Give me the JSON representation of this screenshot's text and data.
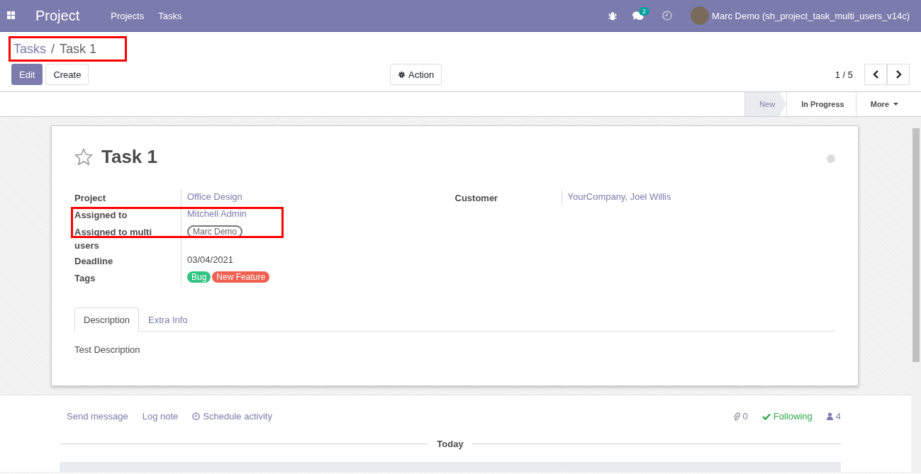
{
  "navbar": {
    "app_name": "Project",
    "menu": [
      "Projects",
      "Tasks"
    ],
    "chat_count": "2",
    "user": "Marc Demo (sh_project_task_multi_users_v14c)"
  },
  "breadcrumb": {
    "highlighted": true,
    "items": [
      "Tasks",
      "Task 1"
    ],
    "separator": "/"
  },
  "buttons": {
    "primary": "Edit",
    "secondary": "Create",
    "action": "Action"
  },
  "pager": "1 / 5",
  "stages": [
    {
      "label": "New",
      "selected": true
    },
    {
      "label": "In Progress",
      "selected": false
    },
    {
      "label": "More",
      "selected": false
    }
  ],
  "sheet": {
    "title": "Task 1",
    "starred": false,
    "left_fields": [
      {
        "label": "Project",
        "kind": "link",
        "value": "Office Design"
      },
      {
        "kind": "annotation",
        "fields": [
          {
            "label": "Assigned to",
            "kind": "link",
            "value": "Mitchell Admin"
          },
          {
            "label": "Assigned to multi users",
            "kind": "pill",
            "value": "Marc Demo"
          }
        ]
      },
      {
        "label": "Deadline",
        "kind": "text",
        "value": "03/04/2021"
      },
      {
        "label": "Tags",
        "kind": "tags",
        "tags": [
          {
            "label": "Bug",
            "color": "#30c381"
          },
          {
            "label": "New Feature",
            "color": "#f06050"
          }
        ]
      }
    ],
    "right_fields": [
      {
        "label": "Customer",
        "kind": "link",
        "value": "YourCompany, Joel Willis"
      }
    ],
    "tabs": [
      {
        "label": "Description",
        "selected": true
      },
      {
        "label": "Extra Info",
        "selected": false
      }
    ],
    "description": "Test Description"
  },
  "chatter": {
    "actions": [
      "Send message",
      "Log note",
      "Schedule activity"
    ],
    "attachments": "0",
    "follow": "Following",
    "followers": "4",
    "separator": "Today"
  }
}
